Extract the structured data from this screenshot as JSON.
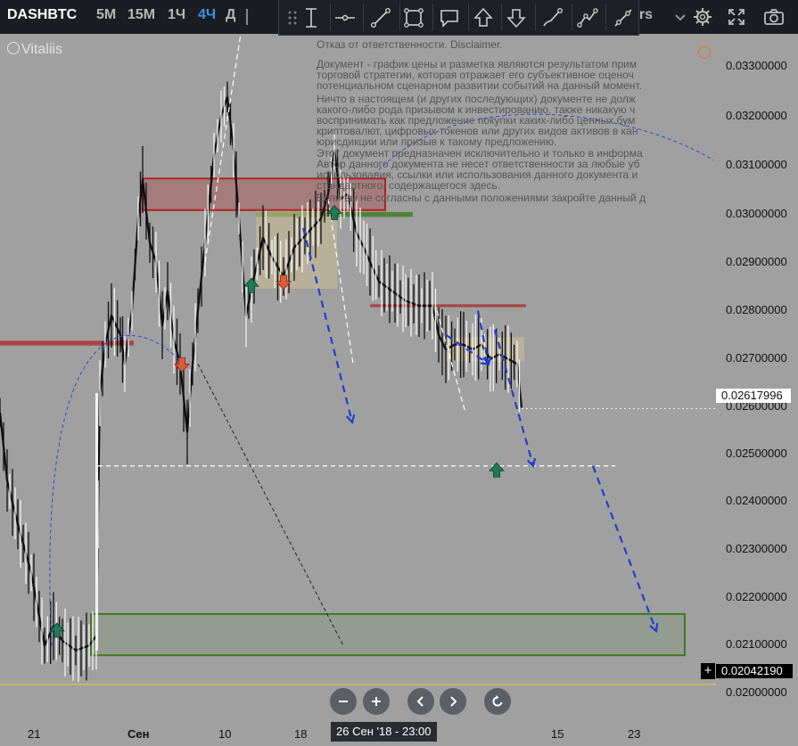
{
  "toolbar": {
    "symbol": "DASHBTC",
    "timeframes": [
      "5M",
      "15M",
      "1Ч",
      "4Ч",
      "Д"
    ],
    "active_timeframe": "4Ч",
    "indicators_label": "ers"
  },
  "watermark": {
    "author": "Vitaliis"
  },
  "disclaimer": {
    "title": "Отказ от ответственности. Disclaimer.",
    "p1": [
      "Документ - график цены и разметка являются результатом прим",
      "торговой стратегии, которая отражает его субъективное оценоч",
      "потенциальном сценарном развитии событий на данный момент."
    ],
    "p2": [
      "Ничто в настоящем (и других последующих) документе не долж",
      "какого-либо рода призывом к инвестированию, также никакую ч",
      "воспринимать как предложение покупки каких-либо ценных бум",
      "криптовалют, цифровых токенов или других видов активов в кан",
      "юрисдикции или призыв к такому предложению."
    ],
    "p3": [
      "Этот документ предназначен исключительно и только в информа",
      "Автор данного документа не несет ответственности за любые уб",
      "использования, ссылки или использования данного документа и",
      "стандартного, содержащегося здесь."
    ],
    "p4": [
      "Если вы не согласны с данными положениями закройте данный д"
    ]
  },
  "price_axis": {
    "labels": [
      "0.03300000",
      "0.03200000",
      "0.03100000",
      "0.03000000",
      "0.02900000",
      "0.02800000",
      "0.02700000",
      "0.02600000",
      "0.02500000",
      "0.02400000",
      "0.02300000",
      "0.02200000",
      "0.02100000",
      "0.02000000"
    ],
    "current_price": "0.02617996",
    "crosshair_price": "0.02042190",
    "crosshair_plus": "+"
  },
  "time_axis": {
    "labels": [
      "21",
      "Сен",
      "10",
      "18",
      "15",
      "23"
    ],
    "cursor_label": "26 Сен '18 - 23:00"
  },
  "colors": {
    "background": "#a0a0a0",
    "toolbar_bg": "#1b1d22",
    "active_tf": "#3d8fe6",
    "resistance": "#b22222",
    "support": "#3f7a1f",
    "zone_fill": "#c2b59a",
    "arrow_blue": "#1e3fd1",
    "up_marker": "#1f7a55",
    "down_marker": "#e05a3a"
  },
  "icons": {
    "drawing_tools": [
      "vertical-line-icon",
      "horizontal-line-icon",
      "trend-line-icon",
      "rectangle-icon",
      "callout-icon",
      "arrow-up-icon",
      "arrow-down-icon",
      "brush-icon",
      "path-icon",
      "pen-icon"
    ],
    "top_right": [
      "settings-gear-icon",
      "fullscreen-icon",
      "camera-icon"
    ],
    "nav": [
      "zoom-out-icon",
      "zoom-in-icon",
      "scroll-left-icon",
      "scroll-right-icon",
      "reset-icon"
    ]
  },
  "chart_data": {
    "type": "candlestick-annotated",
    "symbol": "DASHBTC",
    "interval": "4Ч",
    "ylim": [
      0.0198,
      0.0339
    ],
    "current_price": 0.02617996,
    "price_path": [
      [
        0,
        0.0261
      ],
      [
        8,
        0.0247
      ],
      [
        20,
        0.0238
      ],
      [
        35,
        0.0228
      ],
      [
        50,
        0.0213
      ],
      [
        60,
        0.0217
      ],
      [
        70,
        0.0214
      ],
      [
        85,
        0.0212
      ],
      [
        100,
        0.0213
      ],
      [
        108,
        0.0215
      ],
      [
        112,
        0.0265
      ],
      [
        118,
        0.0275
      ],
      [
        125,
        0.0281
      ],
      [
        135,
        0.0277
      ],
      [
        140,
        0.0271
      ],
      [
        148,
        0.0282
      ],
      [
        155,
        0.0301
      ],
      [
        160,
        0.0309
      ],
      [
        168,
        0.0296
      ],
      [
        175,
        0.0292
      ],
      [
        182,
        0.0279
      ],
      [
        188,
        0.0286
      ],
      [
        195,
        0.0276
      ],
      [
        202,
        0.0271
      ],
      [
        210,
        0.0257
      ],
      [
        216,
        0.0271
      ],
      [
        222,
        0.0282
      ],
      [
        230,
        0.0296
      ],
      [
        240,
        0.0314
      ],
      [
        248,
        0.0322
      ],
      [
        255,
        0.0326
      ],
      [
        262,
        0.0315
      ],
      [
        268,
        0.0301
      ],
      [
        276,
        0.0281
      ],
      [
        285,
        0.0289
      ],
      [
        295,
        0.0297
      ],
      [
        305,
        0.0293
      ],
      [
        318,
        0.0289
      ],
      [
        330,
        0.0295
      ],
      [
        345,
        0.0298
      ],
      [
        360,
        0.0301
      ],
      [
        368,
        0.0306
      ],
      [
        375,
        0.0315
      ],
      [
        382,
        0.0305
      ],
      [
        390,
        0.0306
      ],
      [
        400,
        0.0298
      ],
      [
        408,
        0.0295
      ],
      [
        415,
        0.0292
      ],
      [
        425,
        0.0288
      ],
      [
        440,
        0.0286
      ],
      [
        455,
        0.0284
      ],
      [
        470,
        0.0283
      ],
      [
        485,
        0.0283
      ],
      [
        492,
        0.0277
      ],
      [
        500,
        0.0274
      ],
      [
        510,
        0.0275
      ],
      [
        520,
        0.0275
      ],
      [
        530,
        0.0274
      ],
      [
        540,
        0.0275
      ],
      [
        550,
        0.0272
      ],
      [
        560,
        0.0273
      ],
      [
        570,
        0.0272
      ],
      [
        580,
        0.0271
      ],
      [
        585,
        0.0262
      ]
    ],
    "levels": [
      {
        "price": 0.025,
        "style": "dashed-white",
        "x": [
          110,
          690
        ]
      },
      {
        "price": 0.0205,
        "style": "solid-yellow",
        "x": [
          0,
          803
        ]
      }
    ],
    "zones": [
      {
        "kind": "resistance",
        "x": [
          160,
          432
        ],
        "price": [
          0.03027,
          0.03092
        ]
      },
      {
        "kind": "resistance-line",
        "x": [
          0,
          150
        ],
        "price": [
          0.02748,
          0.02758
        ]
      },
      {
        "kind": "support-line",
        "x": [
          287,
          463
        ],
        "price": [
          0.03013,
          0.03023
        ]
      },
      {
        "kind": "resistance-line",
        "x": [
          415,
          590
        ],
        "price": [
          0.02827,
          0.02833
        ]
      },
      {
        "kind": "range",
        "x": [
          287,
          378
        ],
        "price": [
          0.02865,
          0.03025
        ]
      },
      {
        "kind": "range",
        "x": [
          500,
          588
        ],
        "price": [
          0.02715,
          0.02765
        ]
      },
      {
        "kind": "support",
        "x": [
          102,
          768
        ],
        "price": [
          0.0211,
          0.02195
        ]
      }
    ]
  }
}
